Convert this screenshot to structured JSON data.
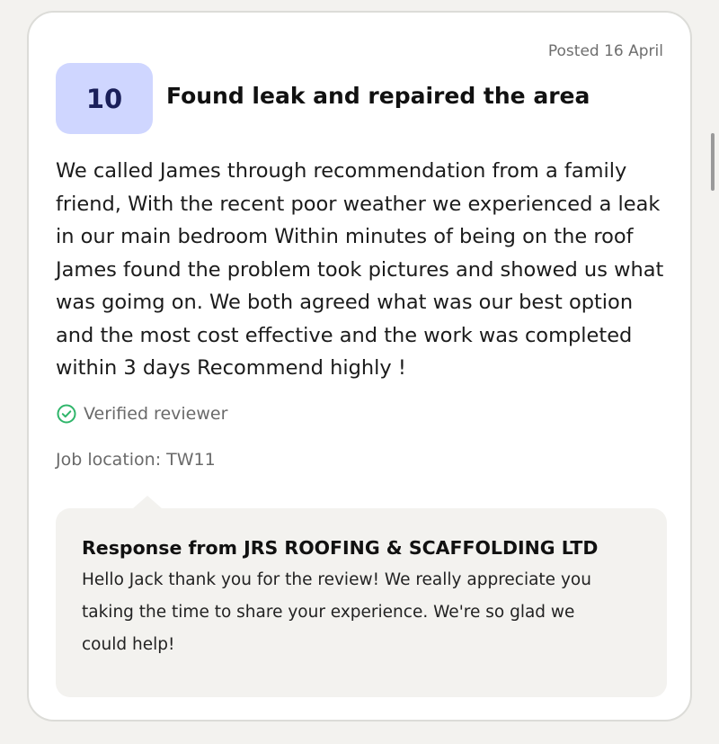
{
  "review": {
    "posted": "Posted 16 April",
    "score": "10",
    "title": "Found leak and repaired the area",
    "body": "We called James through recommendation from a family friend, With the recent poor weather we experienced a leak in our main bedroom Within minutes of being on the roof James found the problem took pictures and showed us what was goimg on. We both agreed what was our best option and the most cost effective and the work was completed within 3 days Recommend highly !",
    "verified_label": "Verified reviewer",
    "verified_icon": "check-circle-icon",
    "location": "Job location: TW11"
  },
  "response": {
    "title": "Response from JRS ROOFING & SCAFFOLDING LTD",
    "body": "Hello Jack thank you for the review! We really appreciate you taking the time to share your experience. We're so glad we could help!"
  },
  "colors": {
    "score_badge_bg": "#cfd6ff",
    "score_text": "#1a1f5a",
    "verified_green": "#2fb56a",
    "response_bg": "#f3f2ef"
  }
}
